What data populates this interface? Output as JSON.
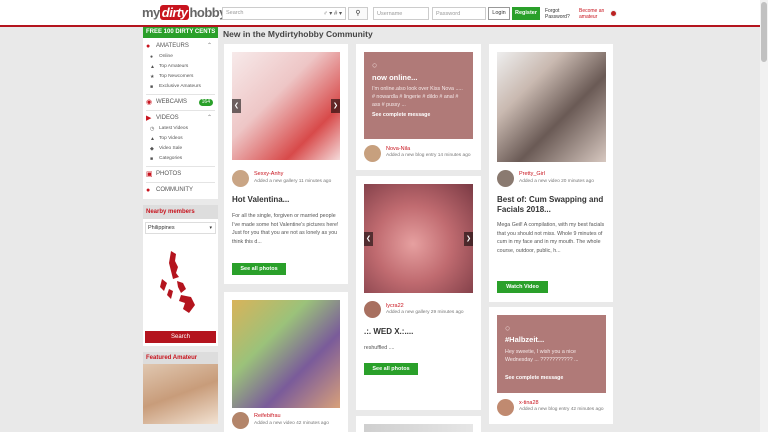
{
  "header": {
    "logo_left": "my",
    "logo_mid": "dirty",
    "logo_right": "hobby",
    "search_placeholder": "Search",
    "search_tools": "♂ ▾ # ▾",
    "search_button_icon": "search-icon",
    "username_placeholder": "Username",
    "password_placeholder": "Password",
    "login_label": "Login",
    "register_label": "Register",
    "forgot_label": "Forgot Password?",
    "become_label": "Become an amateur",
    "flag_icon": "uk-flag-icon"
  },
  "sidebar": {
    "free_banner": "FREE 100 DIRTY CENTS",
    "amateurs": {
      "label": "AMATEURS",
      "items": [
        "Online",
        "Top Amateurs",
        "Top Newcomers",
        "Exclusive Amateurs"
      ]
    },
    "webcams": {
      "label": "WEBCAMS",
      "badge": "164"
    },
    "videos": {
      "label": "VIDEOS",
      "items": [
        "Latest Videos",
        "Top Videos",
        "Video Sale",
        "Categories"
      ]
    },
    "photos_label": "PHOTOS",
    "community_label": "COMMUNITY",
    "nearby_title": "Nearby members",
    "nearby_country": "Philippines",
    "search_button": "Search",
    "featured_title": "Featured Amateur"
  },
  "main": {
    "title": "New in the Mydirtyhobby Community",
    "col1": [
      {
        "user": "Sexxy-Anhy",
        "meta": "Added a new gallery 11 minutes ago",
        "title": "Hot Valentina...",
        "body": "For all the single, forgiven or married people I've made some hot Valentine's pictures here! Just for you that you are not as lonely as you think this d...",
        "button": "See all photos"
      },
      {
        "user": "Reifebifrau",
        "meta": "Added a new video 42 minutes ago"
      }
    ],
    "col2": [
      {
        "blog_title": "now online...",
        "blog_text": "I'm online.also look over Kiss Nova ..... # nowardla # lingerie # dildo # anal # ass # pussy ...",
        "blog_link": "See complete message",
        "user": "Nova-Nila",
        "meta": "Added a new blog entry 14 minutes ago"
      },
      {
        "user": "lycra22",
        "meta": "Added a new gallery 29 minutes ago",
        "title": ".:. WED X.:....",
        "body": "reshuffled ....",
        "button": "See all photos"
      }
    ],
    "col3": [
      {
        "user": "Pretty_Girl",
        "meta": "Added a new video 20 minutes ago",
        "title": "Best of: Cum Swapping and Facials 2018...",
        "body": "Mega Geil! A compilation, with my best facials that you should not miss. Whole 9 minutes of cum in my face and in my mouth. The whole course, outdoor, public, h...",
        "button": "Watch Video"
      },
      {
        "blog_title": "#Halbzeit...",
        "blog_text": "Hey sweetie, I wish you a nice Wednesday ... ??????????? ...",
        "blog_link": "See complete message",
        "user": "x-tina28",
        "meta": "Added a new blog entry 42 minutes ago"
      }
    ]
  }
}
